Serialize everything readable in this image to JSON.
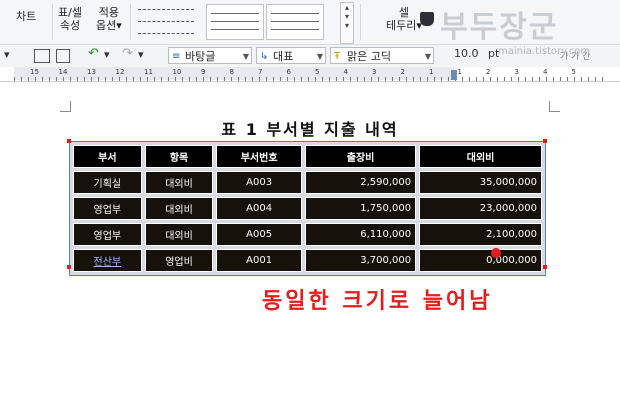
{
  "ribbon": {
    "chart_label": "차트",
    "table_props_line1": "표/셀",
    "table_props_line2": "속성",
    "apply_line1": "적용",
    "apply_line2": "옵션",
    "cell_border_line1": "셀",
    "cell_border_line2": "테두리"
  },
  "toolbar": {
    "font_style": "바탕글",
    "representative": "대표",
    "font_name": "맑은 고딕",
    "font_size": "10.0",
    "unit": "pt",
    "char_icons": "가 가 간"
  },
  "ruler": {
    "numbers": [
      "15",
      "14",
      "13",
      "12",
      "11",
      "10",
      "9",
      "8",
      "7",
      "6",
      "5",
      "4",
      "3",
      "2",
      "1",
      "1",
      "2",
      "3",
      "4",
      "5"
    ]
  },
  "document": {
    "title": "표 1 부서별 지출 내역",
    "annotation": "동일한 크기로 늘어남"
  },
  "table": {
    "headers": [
      "부서",
      "항목",
      "부서번호",
      "출장비",
      "대외비"
    ],
    "rows": [
      [
        "기획실",
        "대외비",
        "A003",
        "2,590,000",
        "35,000,000"
      ],
      [
        "영업부",
        "대외비",
        "A004",
        "1,750,000",
        "23,000,000"
      ],
      [
        "영업부",
        "대외비",
        "A005",
        "6,110,000",
        "2,100,000"
      ],
      [
        "전산부",
        "영업비",
        "A001",
        "3,700,000",
        "0,000,000"
      ]
    ]
  },
  "watermark": {
    "text": "부두장군",
    "url": "mainia.tistory.com"
  },
  "colors": {
    "annotation": "#e81b1b",
    "table_bg": "#000000"
  }
}
